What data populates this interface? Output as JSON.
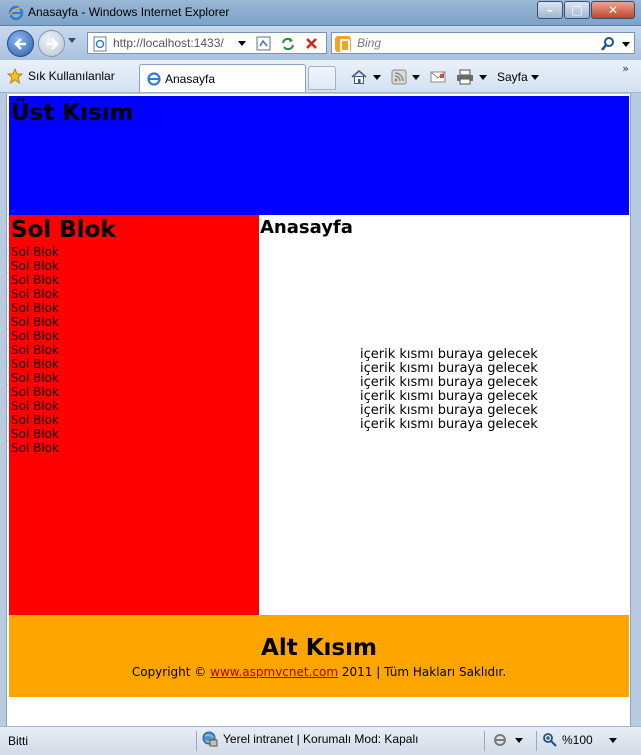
{
  "window": {
    "title": "Anasayfa - Windows Internet Explorer"
  },
  "address_bar": {
    "url": "http://localhost:1433/"
  },
  "search": {
    "placeholder": "Bing"
  },
  "favorites": {
    "label": "Sık Kullanılanlar"
  },
  "tab": {
    "label": "Anasayfa"
  },
  "command_bar": {
    "page_label": "Sayfa"
  },
  "page": {
    "header_title": "Üst Kısım",
    "sidebar_title": "Sol Blok",
    "sidebar_items": [
      "Sol Blok",
      "Sol Blok",
      "Sol Blok",
      "Sol Blok",
      "Sol Blok",
      "Sol Blok",
      "Sol Blok",
      "Sol Blok",
      "Sol Blok",
      "Sol Blok",
      "Sol Blok",
      "Sol Blok",
      "Sol Blok",
      "Sol Blok",
      "Sol Blok"
    ],
    "main_title": "Anasayfa",
    "main_lines": [
      "içerik kısmı buraya gelecek",
      "içerik kısmı buraya gelecek",
      "içerik kısmı buraya gelecek",
      "içerik kısmı buraya gelecek",
      "içerik kısmı buraya gelecek",
      "içerik kısmı buraya gelecek"
    ],
    "footer_title": "Alt Kısım",
    "copyright_prefix": "Copyright ©",
    "copyright_link": "www.aspmvcnet.com",
    "copyright_suffix": "2011 | Tüm Hakları Saklıdır.",
    "colors": {
      "header": "#0000ff",
      "sidebar": "#ff0000",
      "footer": "#ffa500"
    }
  },
  "status_bar": {
    "status": "Bitti",
    "zone": "Yerel intranet | Korumalı Mod: Kapalı",
    "zoom": "%100"
  }
}
